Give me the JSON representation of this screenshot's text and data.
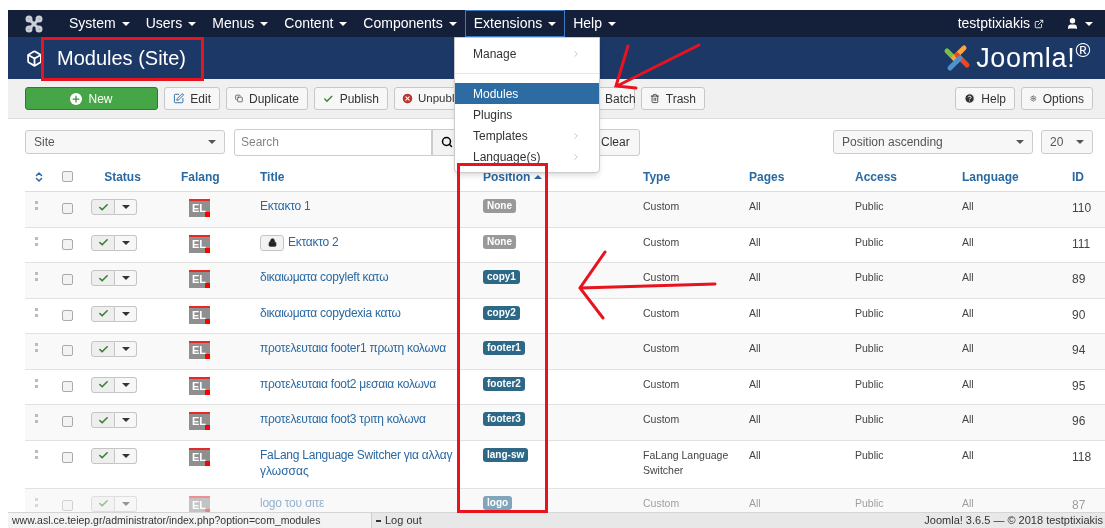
{
  "navbar": {
    "items": [
      {
        "label": "System",
        "selected": false
      },
      {
        "label": "Users",
        "selected": false
      },
      {
        "label": "Menus",
        "selected": false
      },
      {
        "label": "Content",
        "selected": false
      },
      {
        "label": "Components",
        "selected": false
      },
      {
        "label": "Extensions",
        "selected": true
      },
      {
        "label": "Help",
        "selected": false
      }
    ],
    "site_link": "testptixiakis"
  },
  "extensions_menu": [
    {
      "label": "Manage",
      "submenu": true,
      "selected": false
    },
    {
      "kind": "divider"
    },
    {
      "label": "Modules",
      "submenu": false,
      "selected": true
    },
    {
      "label": "Plugins",
      "submenu": false,
      "selected": false
    },
    {
      "label": "Templates",
      "submenu": true,
      "selected": false
    },
    {
      "label": "Language(s)",
      "submenu": true,
      "selected": false
    }
  ],
  "header": {
    "title": "Modules (Site)",
    "logo_text": "Joomla!$^{®}$"
  },
  "toolbar": {
    "left": [
      {
        "kind": "new",
        "label": "New"
      },
      {
        "kind": "edit",
        "label": "Edit"
      },
      {
        "kind": "duplicate",
        "label": "Duplicate"
      },
      {
        "kind": "publish",
        "label": "Publish"
      },
      {
        "kind": "unpublish",
        "label": "Unpubl"
      },
      {
        "kind": "batch",
        "label": "Batch"
      },
      {
        "kind": "trash",
        "label": "Trash"
      }
    ],
    "right": [
      {
        "kind": "help",
        "label": "Help"
      },
      {
        "kind": "options",
        "label": "Options"
      }
    ]
  },
  "filters": {
    "client": "Site",
    "search_placeholder": "Search",
    "clear": "Clear",
    "ordering": "Position ascending",
    "limit": "20"
  },
  "table": {
    "select_all_checked": false,
    "columns": [
      {
        "label": "Status",
        "sorted": false
      },
      {
        "label": "Falang",
        "sorted": false
      },
      {
        "label": "Title",
        "sorted": false
      },
      {
        "label": "Position",
        "sorted": true
      },
      {
        "label": "Type",
        "sorted": false
      },
      {
        "label": "Pages",
        "sorted": false
      },
      {
        "label": "Access",
        "sorted": false
      },
      {
        "label": "Language",
        "sorted": false
      },
      {
        "label": "ID",
        "sorted": false
      }
    ],
    "rows": [
      {
        "checked": false,
        "published": true,
        "falang": "EL",
        "title": "Εκτακτο 1",
        "locked": false,
        "position": "None",
        "color": "#999999",
        "type": "Custom",
        "pages": "All",
        "access": "Public",
        "language": "All",
        "id": "110",
        "dimmed": false
      },
      {
        "checked": false,
        "published": true,
        "falang": "EL",
        "title": "Εκτακτο 2",
        "locked": true,
        "position": "None",
        "color": "#999999",
        "type": "Custom",
        "pages": "All",
        "access": "Public",
        "language": "All",
        "id": "111",
        "dimmed": false
      },
      {
        "checked": false,
        "published": true,
        "falang": "EL",
        "title": "δικαιωματα copyleft κατω",
        "locked": false,
        "position": "copy1",
        "color": "#2d6987",
        "type": "Custom",
        "pages": "All",
        "access": "Public",
        "language": "All",
        "id": "89",
        "dimmed": false
      },
      {
        "checked": false,
        "published": true,
        "falang": "EL",
        "title": "δικαιωματα copydexia κατω",
        "locked": false,
        "position": "copy2",
        "color": "#2d6987",
        "type": "Custom",
        "pages": "All",
        "access": "Public",
        "language": "All",
        "id": "90",
        "dimmed": false
      },
      {
        "checked": false,
        "published": true,
        "falang": "EL",
        "title": "προτελευταια footer1 πρωτη κολωνα",
        "locked": false,
        "position": "footer1",
        "color": "#2d6987",
        "type": "Custom",
        "pages": "All",
        "access": "Public",
        "language": "All",
        "id": "94",
        "dimmed": false
      },
      {
        "checked": false,
        "published": true,
        "falang": "EL",
        "title": "προτελευταια foot2 μεσαια κολωνα",
        "locked": false,
        "position": "footer2",
        "color": "#2d6987",
        "type": "Custom",
        "pages": "All",
        "access": "Public",
        "language": "All",
        "id": "95",
        "dimmed": false
      },
      {
        "checked": false,
        "published": true,
        "falang": "EL",
        "title": "προτελευταια foot3 τριτη κολωνα",
        "locked": false,
        "position": "footer3",
        "color": "#2d6987",
        "type": "Custom",
        "pages": "All",
        "access": "Public",
        "language": "All",
        "id": "96",
        "dimmed": false
      },
      {
        "checked": false,
        "published": true,
        "falang": "EL",
        "title": "FaLang Language Switcher για αλλαγ",
        "title_line2": "γλωσσας",
        "locked": false,
        "position": "lang-sw",
        "color": "#2d6987",
        "type": "FaLang Language Switcher",
        "pages": "All",
        "access": "Public",
        "language": "All",
        "id": "118",
        "dimmed": false
      },
      {
        "checked": false,
        "published": true,
        "falang": "EL",
        "title": "logo του σιτε",
        "locked": false,
        "position": "logo",
        "color": "#7fa6ba",
        "type": "Custom",
        "pages": "All",
        "access": "Public",
        "language": "All",
        "id": "87",
        "dimmed": true
      }
    ]
  },
  "status_bar": {
    "url": "www.asl.ce.teiep.gr/administrator/index.php?option=com_modules",
    "logout": "Log out",
    "footer": "Joomla! 3.6.5 — © 2018 testptixiakis"
  }
}
